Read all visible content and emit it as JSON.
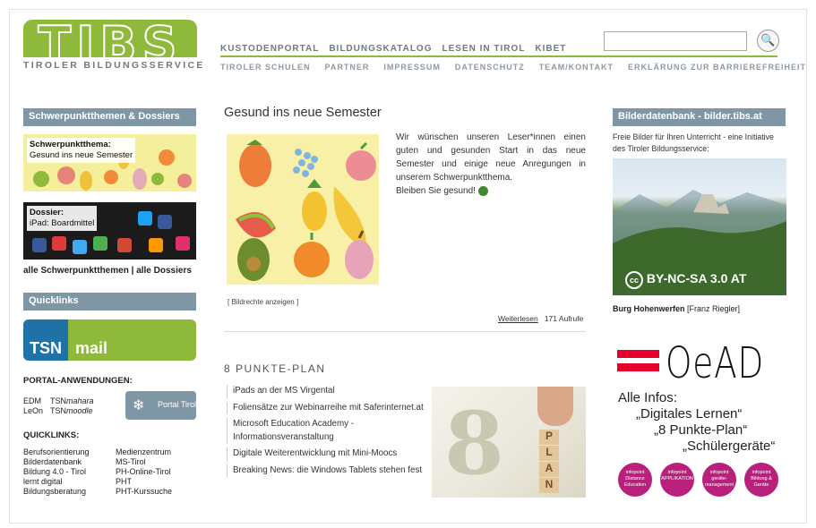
{
  "logo": {
    "title": "TIBS",
    "subtitle": "TIROLER BILDUNGSSERVICE"
  },
  "nav_primary": [
    "KUSTODENPORTAL",
    "BILDUNGSKATALOG",
    "LESEN IN TIROL",
    "KIBET"
  ],
  "nav_secondary": [
    "TIROLER SCHULEN",
    "PARTNER",
    "IMPRESSUM",
    "DATENSCHUTZ",
    "TEAM/KONTAKT",
    "ERKLÄRUNG ZUR BARRIEREFREIHEIT"
  ],
  "search": {
    "value": "",
    "icon": "search-icon"
  },
  "left": {
    "themes_header": "Schwerpunktthemen & Dossiers",
    "thumb1": {
      "kind": "Schwerpunktthema:",
      "title": "Gesund ins neue Semester"
    },
    "thumb2": {
      "kind": "Dossier:",
      "title": "iPad: Boardmittel"
    },
    "all_themes": "alle Schwerpunktthemen",
    "separator": "|",
    "all_dossiers": "alle Dossiers",
    "quicklinks_header": "Quicklinks",
    "tsn_mail": {
      "left": "TSN",
      "right": "mail"
    },
    "portal_head": "PORTAL-ANWENDUNGEN:",
    "portal_rows": [
      {
        "a": "EDM",
        "b": "TSN",
        "b_em": "mahara"
      },
      {
        "a": "LeOn",
        "b": "TSN",
        "b_em": "moodle"
      }
    ],
    "portal_tirol": "Portal Tirol",
    "quicklinks_head": "QUICKLINKS:",
    "quicklinks": [
      [
        "Berufsorientierung",
        "Medienzentrum"
      ],
      [
        "Bilderdatenbank",
        "MS-Tirol"
      ],
      [
        "Bildung 4.0 - Tirol",
        "PH-Online-Tirol"
      ],
      [
        "lernt digital",
        "PHT"
      ],
      [
        "Bildungsberatung",
        "PHT-Kurssuche"
      ]
    ]
  },
  "center": {
    "title": "Gesund ins neue Semester",
    "intro": "Wir wünschen unseren Leser*innen einen guten und gesunden Start in das neue Semester und einige neue Anregungen in unserem Schwerpunktthema.",
    "intro2": "Bleiben Sie gesund!",
    "rights": "[ Bildrechte anzeigen ]",
    "read_more": "Weiterlesen",
    "views": "171 Aufrufe",
    "plan_title": "8 PUNKTE-PLAN",
    "plan_items": [
      "iPads an der MS Virgental",
      "Foliensätze zur Webinarreihe mit Saferinternet.at",
      "Microsoft Education Academy - Informationsveranstaltung",
      "Digitale Weiterentwicklung mit Mini-Moocs",
      "Breaking News: die Windows Tablets stehen fest"
    ],
    "plan_image": {
      "number": "8",
      "letters": [
        "P",
        "L",
        "A",
        "N"
      ]
    }
  },
  "right": {
    "header": "Bilderdatenbank - bilder.tibs.at",
    "text": "Freie Bilder für Ihren Unterricht - eine Initiative des Tiroler Bildungsservice:",
    "license": "BY-NC-SA 3.0 AT",
    "license_icon": "cc",
    "caption_bold": "Burg Hohenwerfen",
    "caption_rest": " [Franz Riegler]",
    "oead": "OeAD",
    "infos": [
      "Alle Infos:",
      "„Digitales Lernen“",
      "„8 Punkte-Plan“",
      "„Schülergeräte“"
    ],
    "badges": [
      {
        "top": "infopoint",
        "bottom": "Distance Education"
      },
      {
        "top": "infopoint",
        "bottom": "APPLIKATION"
      },
      {
        "top": "infopoint",
        "bottom": "geräte-management"
      },
      {
        "top": "infopoint",
        "bottom": "Bildung & Geräte"
      }
    ]
  },
  "colors": {
    "brand_green": "#8fb93a",
    "side_header": "#7f96a5",
    "tsn_blue": "#1f72a8",
    "badge": "#b8207c",
    "oead_red": "#e4002b"
  }
}
